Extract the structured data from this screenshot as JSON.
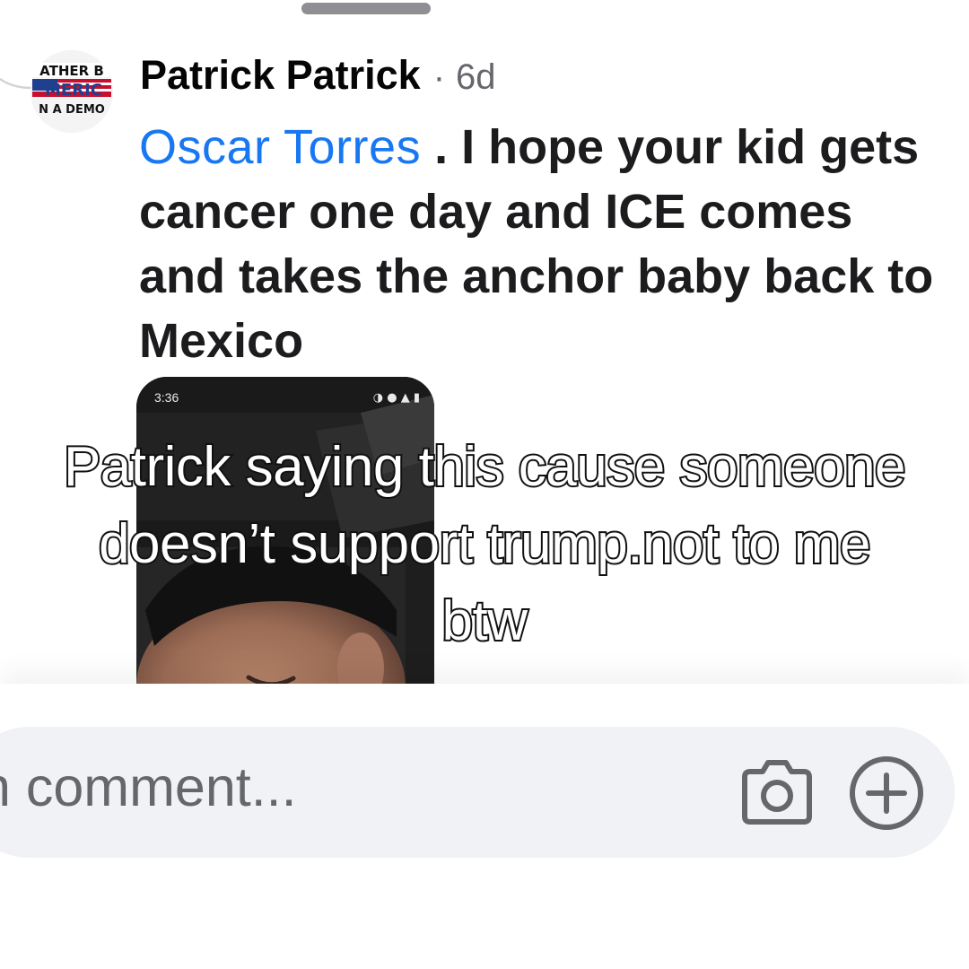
{
  "comment": {
    "author": "Patrick Patrick",
    "separator": "·",
    "timestamp": "6d",
    "avatar_icon": "profile-picture-rather-be-in-america-logo",
    "mention": "Oscar Torres",
    "body": " . I hope your kid gets cancer one day and ICE comes and takes the anchor baby back to Mexico",
    "attachment": {
      "type": "photo-screenshot",
      "status_time": "3:36",
      "status_icons": "◑ ● ▲ ▮"
    }
  },
  "caption": {
    "text": "Patrick saying this cause someone doesn’t support trump.not to me btw"
  },
  "composer": {
    "placeholder": "n comment...",
    "camera_icon": "camera-icon",
    "add_icon": "plus-circle-icon"
  },
  "colors": {
    "mention": "#1877f2",
    "text": "#1c1c1e",
    "secondary": "#65676b",
    "composer_bg": "#f0f2f5"
  }
}
